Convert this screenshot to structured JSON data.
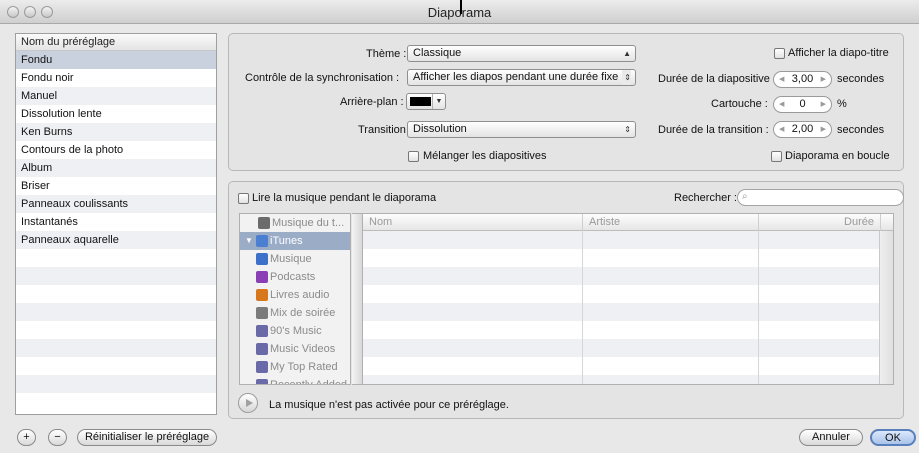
{
  "window": {
    "title": "Diaporama"
  },
  "presets": {
    "header": "Nom du préréglage",
    "items": [
      "Fondu",
      "Fondu noir",
      "Manuel",
      "Dissolution lente",
      "Ken Burns",
      "Contours de la photo",
      "Album",
      "Briser",
      "Panneaux coulissants",
      "Instantanés",
      "Panneaux aquarelle"
    ],
    "selected": "Fondu"
  },
  "buttons": {
    "add": "+",
    "remove": "−",
    "reset": "Réinitialiser le préréglage",
    "cancel": "Annuler",
    "ok": "OK"
  },
  "settings": {
    "theme_label": "Thème :",
    "theme_value": "Classique",
    "sync_label": "Contrôle de la synchronisation :",
    "sync_value": "Afficher les diapos pendant une durée fixe",
    "background_label": "Arrière-plan :",
    "background_color": "#000000",
    "transition_label": "Transition :",
    "transition_value": "Dissolution",
    "shuffle_label": "Mélanger les diapositives",
    "show_title_label": "Afficher la diapo-titre",
    "slide_duration_label": "Durée de la diapositive :",
    "slide_duration_value": "3,00",
    "slide_duration_unit": "secondes",
    "cartouche_label": "Cartouche :",
    "cartouche_value": "0",
    "cartouche_unit": "%",
    "transition_duration_label": "Durée de la transition :",
    "transition_duration_value": "2,00",
    "transition_duration_unit": "secondes",
    "loop_label": "Diaporama en boucle"
  },
  "music": {
    "play_checkbox_label": "Lire la musique pendant le diaporama",
    "search_label": "Rechercher :",
    "search_placeholder": "",
    "sources": [
      {
        "label": "Musique du t...",
        "icon": "film-icon",
        "color": "#6b6b6b"
      },
      {
        "label": "iTunes",
        "icon": "itunes-icon",
        "color": "#4b7fd1"
      },
      {
        "label": "Musique",
        "icon": "music-note-icon",
        "color": "#3d71c9"
      },
      {
        "label": "Podcasts",
        "icon": "podcast-icon",
        "color": "#8a3fb5"
      },
      {
        "label": "Livres audio",
        "icon": "audiobook-icon",
        "color": "#d8781c"
      },
      {
        "label": "Mix de soirée",
        "icon": "party-mix-icon",
        "color": "#7b7b7b"
      },
      {
        "label": "90's Music",
        "icon": "smart-playlist-icon",
        "color": "#6a6aa8"
      },
      {
        "label": "Music Videos",
        "icon": "smart-playlist-icon",
        "color": "#6a6aa8"
      },
      {
        "label": "My Top Rated",
        "icon": "smart-playlist-icon",
        "color": "#6a6aa8"
      },
      {
        "label": "Recently Added",
        "icon": "smart-playlist-icon",
        "color": "#6a6aa8"
      }
    ],
    "columns": [
      "Nom",
      "Artiste",
      "Durée"
    ],
    "status": "La musique n'est pas activée pour ce préréglage."
  }
}
